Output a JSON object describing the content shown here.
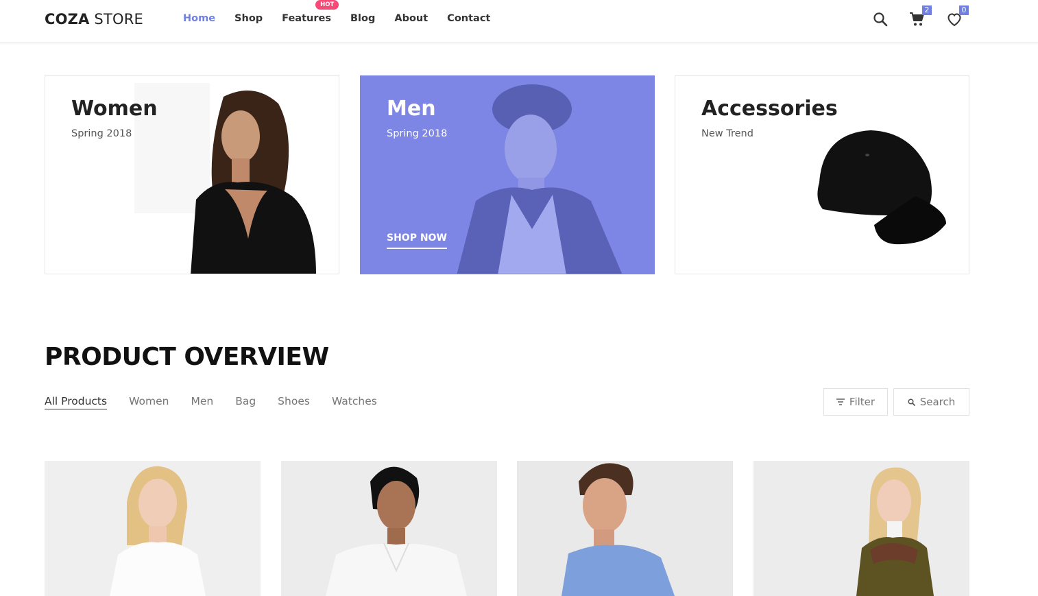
{
  "header": {
    "logo_bold": "COZA",
    "logo_light": " STORE",
    "nav": [
      {
        "label": "Home"
      },
      {
        "label": "Shop"
      },
      {
        "label": "Features",
        "badge": "HOT"
      },
      {
        "label": "Blog"
      },
      {
        "label": "About"
      },
      {
        "label": "Contact"
      }
    ],
    "icons": [
      "search-icon",
      "cart-icon",
      "heart-icon"
    ],
    "cart_count": "2",
    "wishlist_count": "0"
  },
  "banners": [
    {
      "title": "Women",
      "subtitle": "Spring 2018"
    },
    {
      "title": "Men",
      "subtitle": "Spring 2018",
      "cta": "SHOP NOW"
    },
    {
      "title": "Accessories",
      "subtitle": "New Trend"
    }
  ],
  "overview": {
    "title": "PRODUCT OVERVIEW",
    "filters": [
      "All Products",
      "Women",
      "Men",
      "Bag",
      "Shoes",
      "Watches"
    ],
    "filter_button": "Filter",
    "search_button": "Search"
  },
  "colors": {
    "accent": "#717fe0",
    "hot_badge": "#f74877",
    "men_banner": "#7d86e4"
  }
}
